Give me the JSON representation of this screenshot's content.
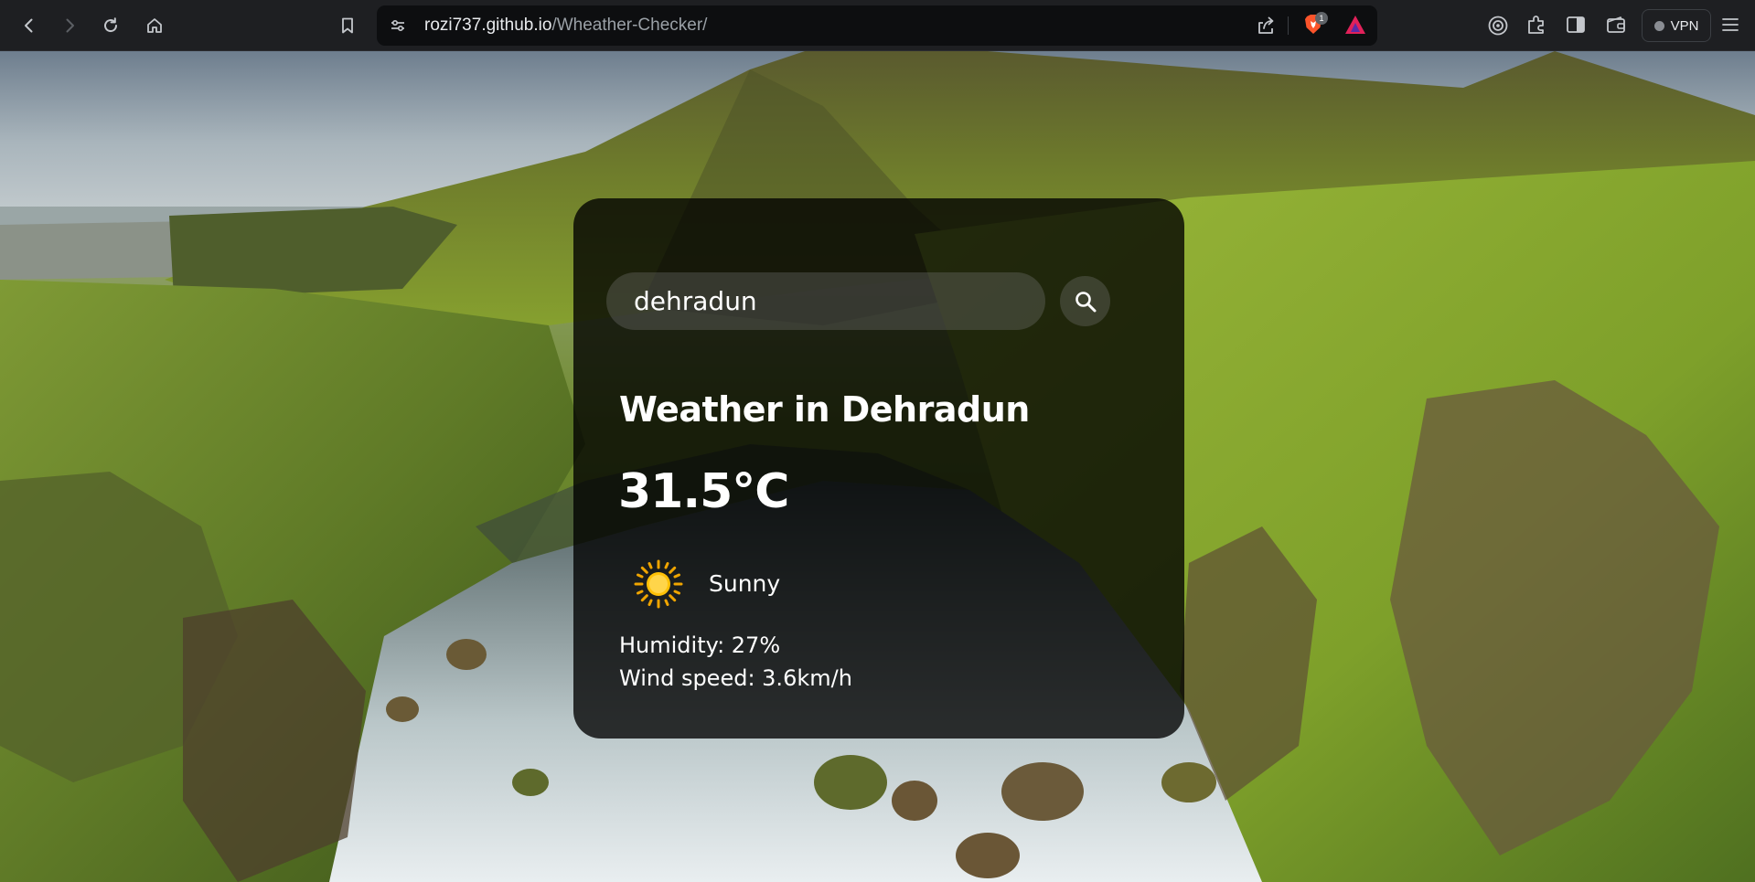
{
  "browser": {
    "url_host": "rozi737.github.io",
    "url_path": "/Wheather-Checker/",
    "brave_shield_count": "1",
    "vpn_label": "VPN",
    "icons": [
      "back-icon",
      "forward-icon",
      "reload-icon",
      "home-icon",
      "bookmark-icon",
      "site-settings-icon",
      "share-icon",
      "brave-shields-icon",
      "brave-rewards-icon",
      "leo-ai-icon",
      "extensions-icon",
      "sidebar-icon",
      "wallet-icon",
      "menu-icon"
    ]
  },
  "weather": {
    "search_value": "dehradun",
    "city": "Weather in Dehradun",
    "temperature": "31.5°C",
    "description": "Sunny",
    "icon": "sun-icon",
    "humidity": "Humidity: 27%",
    "wind": "Wind speed: 3.6km/h"
  },
  "colors": {
    "card_background": "#000000",
    "chrome_background": "#1e1f22",
    "omnibox_background": "#0d0e10",
    "text": "#ffffff",
    "sun": "#ffc107"
  }
}
